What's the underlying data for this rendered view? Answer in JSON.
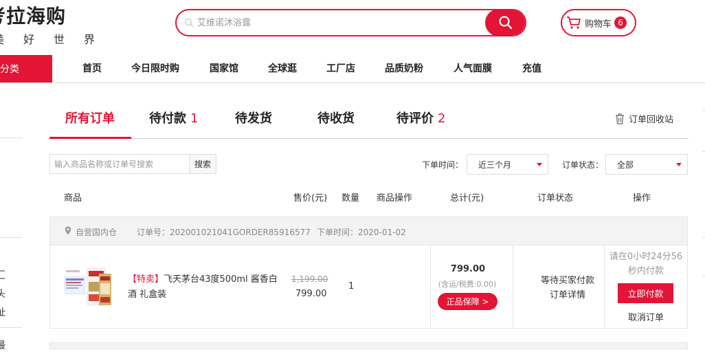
{
  "header": {
    "logo_text": "考拉海购",
    "slogan": [
      "美",
      "好",
      "世",
      "界"
    ],
    "search_placeholder": "艾维诺沐浴露",
    "cart_label": "购物车",
    "cart_count": "6"
  },
  "nav": {
    "category_label": "分类",
    "items": [
      "首页",
      "今日限时购",
      "国家馆",
      "全球逛",
      "工厂店",
      "品质奶粉",
      "人气面膜",
      "充值"
    ]
  },
  "left_sidebar_fragments": [
    "汇",
    "头",
    "址",
    "最"
  ],
  "tabs": [
    {
      "label": "所有订单",
      "count": ""
    },
    {
      "label": "待付款",
      "count": "1"
    },
    {
      "label": "待发货",
      "count": ""
    },
    {
      "label": "待收货",
      "count": ""
    },
    {
      "label": "待评价",
      "count": "2"
    }
  ],
  "recycle_bin": "订单回收站",
  "filters": {
    "search_placeholder": "输入商品名称或订单号搜索",
    "search_button": "搜索",
    "time_label": "下单时间：",
    "time_value": "近三个月",
    "status_label": "订单状态：",
    "status_value": "全部"
  },
  "table_headers": [
    "商品",
    "售价(元)",
    "数量",
    "商品操作",
    "总计(元)",
    "订单状态",
    "操作"
  ],
  "order": {
    "warehouse": "自营国内仓",
    "order_no": "订单号：202001021041GORDER85916577",
    "order_time": "下单时间：2020-01-02",
    "product_tag": "【特卖】",
    "product_name": "飞天茅台43度500ml 酱香白酒 礼盒装",
    "price_original": "1,199.00",
    "price": "799.00",
    "quantity": "1",
    "total": "799.00",
    "total_note": "(含运/税费:0.00)",
    "guarantee": "正品保障 >",
    "status": "等待买家付款",
    "detail_link": "订单详情",
    "countdown": "请在0小时24分56秒内付款",
    "pay_button": "立即付款",
    "cancel_link": "取消订单"
  },
  "colors": {
    "accent": "#e31436"
  }
}
